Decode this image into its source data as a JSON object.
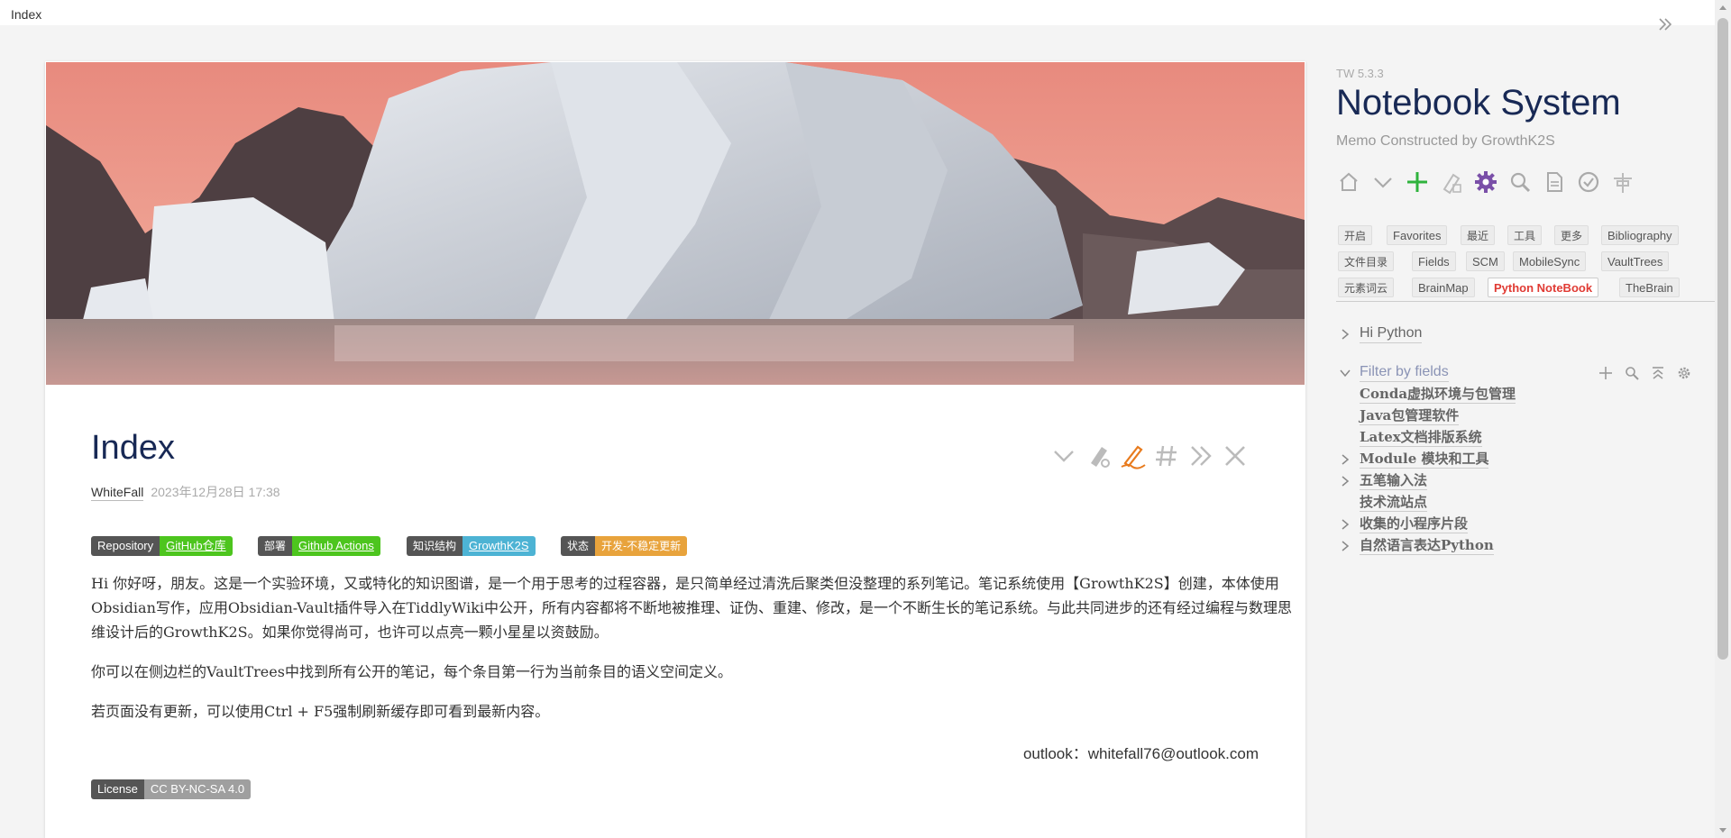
{
  "window": {
    "title": "Index"
  },
  "story": {
    "title": "Index",
    "author": "WhiteFall",
    "date": "2023年12月28日 17:38",
    "badges": [
      {
        "label": "Repository",
        "value": "GitHub仓库",
        "color": "#4dc51e"
      },
      {
        "label": "部署",
        "value": "Github Actions",
        "color": "#4dc51e"
      },
      {
        "label": "知识结构",
        "value": "GrowthK2S",
        "color": "#4db3d4"
      },
      {
        "label": "状态",
        "value": "开发-不稳定更新",
        "color": "#e8a33c"
      }
    ],
    "paragraphs": [
      "Hi 你好呀，朋友。这是一个实验环境，又或特化的知识图谱，是一个用于思考的过程容器，是只简单经过清洗后聚类但没整理的系列笔记。笔记系统使用【GrowthK2S】创建，本体使用Obsidian写作，应用Obsidian-Vault插件导入在TiddlyWiki中公开，所有内容都将不断地被推理、证伪、重建、修改，是一个不断生长的笔记系统。与此共同进步的还有经过编程与数理思维设计后的GrowthK2S。如果你觉得尚可，也许可以点亮一颗小星星以资鼓励。",
      "你可以在侧边栏的VaultTrees中找到所有公开的笔记，每个条目第一行为当前条目的语义空间定义。",
      "若页面没有更新，可以使用Ctrl + F5强制刷新缓存即可看到最新内容。"
    ],
    "email": "outlook：whitefall76@outlook.com",
    "license": {
      "label": "License",
      "value": "CC BY-NC-SA 4.0",
      "color": "#9f9f9f"
    }
  },
  "sidebar": {
    "version": "TW 5.3.3",
    "site_title": "Notebook System",
    "site_subtitle": "Memo Constructed by GrowthK2S",
    "page_controls": [
      "home-icon",
      "more-chevron-icon",
      "new-tiddler-icon",
      "new-journal-icon",
      "control-panel-gear-icon",
      "advanced-search-icon",
      "import-icon",
      "save-wiki-icon",
      "layout-icon"
    ],
    "tabs": [
      "开启",
      "Favorites",
      "最近",
      "工具",
      "更多",
      "Bibliography",
      "文件目录",
      "Fields",
      "SCM",
      "MobileSync",
      "VaultTrees",
      "元素词云",
      "BrainMap",
      "Python NoteBook",
      "TheBrain"
    ],
    "active_tab": "Python NoteBook",
    "tree": {
      "hi_python": "Hi Python",
      "filter": "Filter by fields",
      "items": [
        {
          "label": "Conda虚拟环境与包管理",
          "expandable": false
        },
        {
          "label": "Java包管理软件",
          "expandable": false
        },
        {
          "label": "Latex文档排版系统",
          "expandable": false
        },
        {
          "label": "Module 模块和工具",
          "expandable": true
        },
        {
          "label": "五笔输入法",
          "expandable": true
        },
        {
          "label": "技术流站点",
          "expandable": false
        },
        {
          "label": "收集的小程序片段",
          "expandable": true
        },
        {
          "label": "自然语言表达Python",
          "expandable": true
        }
      ]
    }
  },
  "colors": {
    "title": "#182955",
    "active_tab": "#e03b34",
    "edit_pencil": "#e87b1e",
    "add": "#2fb33d",
    "gear": "#7a4fa8"
  }
}
